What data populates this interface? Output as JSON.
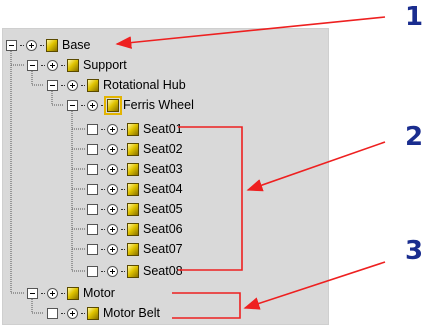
{
  "tree": {
    "nodes": [
      {
        "label": "Base"
      },
      {
        "label": "Support"
      },
      {
        "label": "Rotational Hub"
      },
      {
        "label": "Ferris Wheel"
      },
      {
        "label": "Seat01"
      },
      {
        "label": "Seat02"
      },
      {
        "label": "Seat03"
      },
      {
        "label": "Seat04"
      },
      {
        "label": "Seat05"
      },
      {
        "label": "Seat06"
      },
      {
        "label": "Seat07"
      },
      {
        "label": "Seat08"
      },
      {
        "label": "Motor"
      },
      {
        "label": "Motor Belt"
      }
    ]
  },
  "callouts": [
    "1",
    "2",
    "3"
  ],
  "colors": {
    "arrow": "#ee2020",
    "callout": "#1a2d8f",
    "panel": "#d9d9d9"
  }
}
